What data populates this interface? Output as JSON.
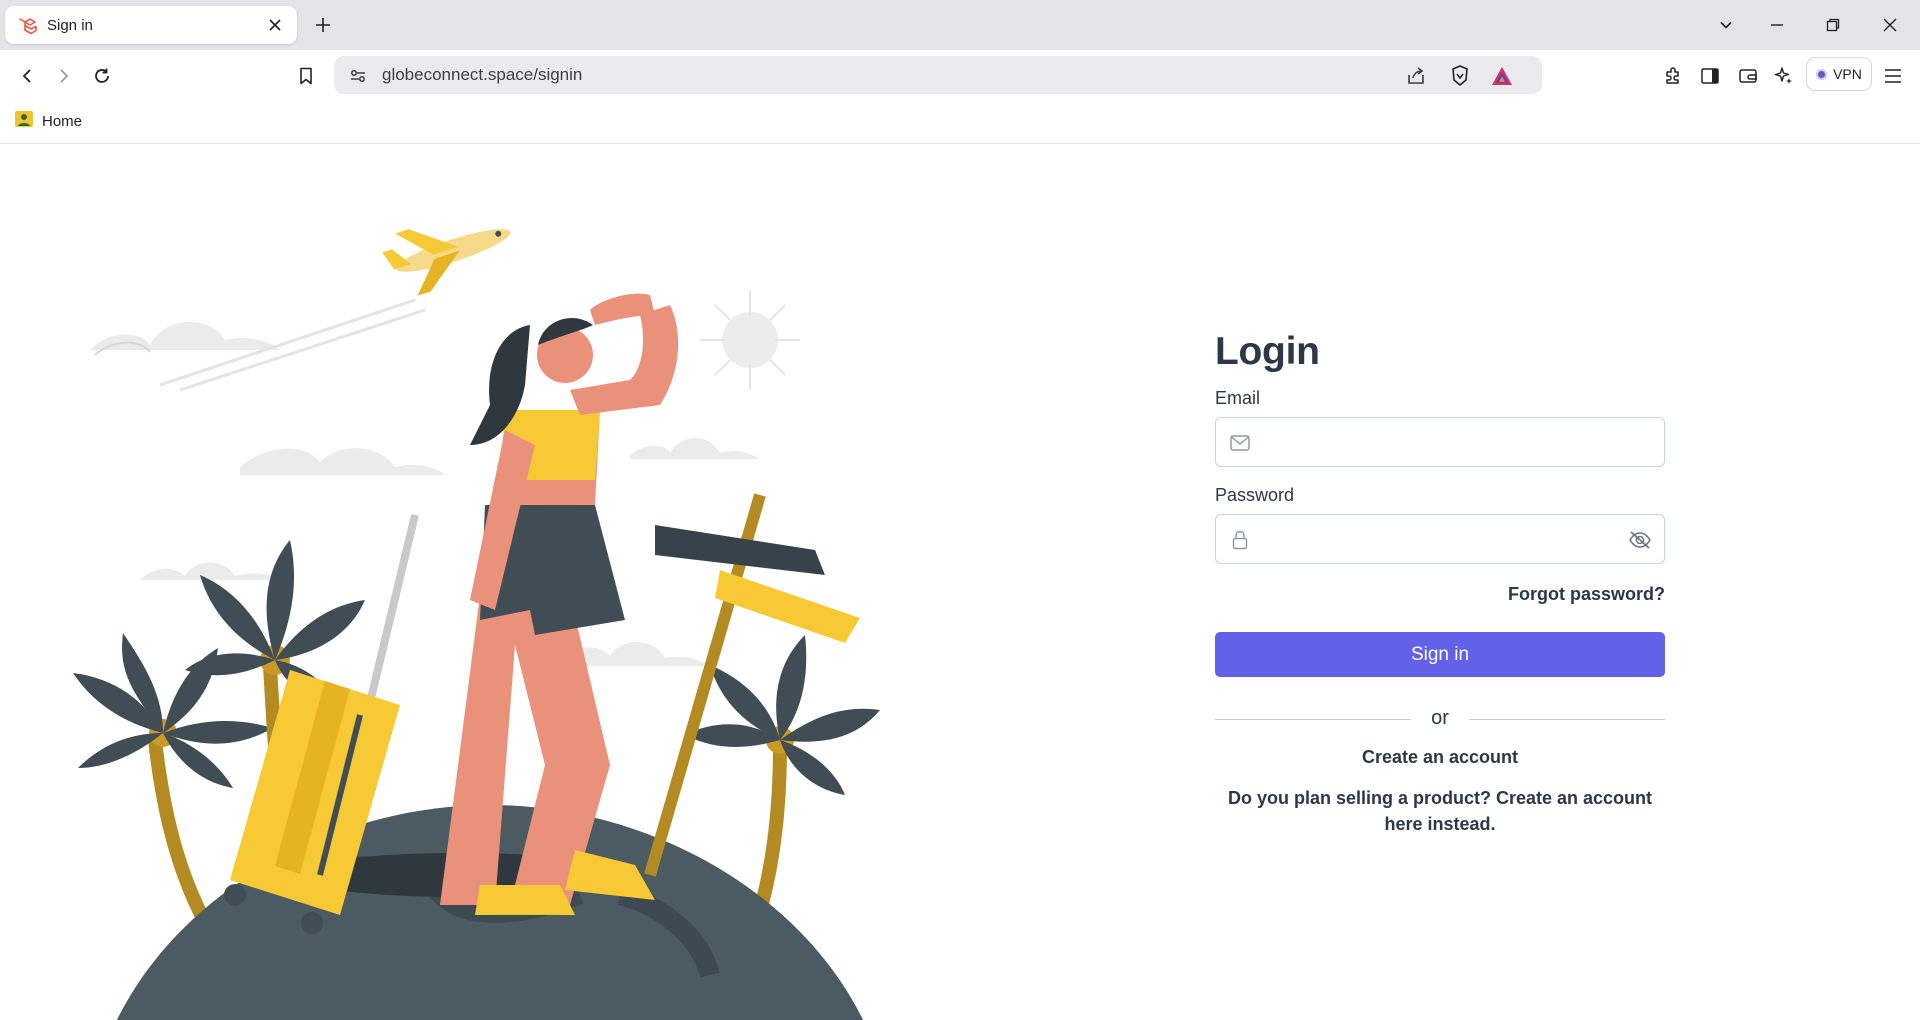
{
  "browser": {
    "tab": {
      "title": "Sign in",
      "favicon": "laravel-logo-icon"
    },
    "address": "globeconnect.space/signin",
    "vpn_label": "VPN",
    "bookmarks": [
      {
        "label": "Home"
      }
    ]
  },
  "login": {
    "title": "Login",
    "email_label": "Email",
    "email_value": "",
    "password_label": "Password",
    "password_value": "",
    "forgot": "Forgot password?",
    "submit": "Sign in",
    "or": "or",
    "create_account": "Create an account",
    "seller_prompt": "Do you plan selling a product? Create an account here instead."
  },
  "colors": {
    "accent": "#6261e8",
    "text": "#2d3748",
    "illustration_yellow": "#f7c935",
    "illustration_dark": "#414d54",
    "illustration_skin": "#ea917c"
  }
}
